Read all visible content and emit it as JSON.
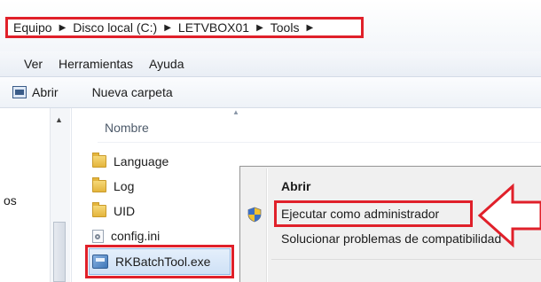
{
  "address_bar": {
    "crumbs": [
      "Equipo",
      "Disco local (C:)",
      "LETVBOX01",
      "Tools"
    ]
  },
  "menu": {
    "items": [
      "Ver",
      "Herramientas",
      "Ayuda"
    ]
  },
  "toolbar": {
    "open_label": "Abrir",
    "new_folder_label": "Nueva carpeta"
  },
  "nav_pane": {
    "partial_label": "os"
  },
  "file_list": {
    "column_name": "Nombre",
    "items": [
      {
        "name": "Language",
        "icon": "folder-icon"
      },
      {
        "name": "Log",
        "icon": "folder-icon"
      },
      {
        "name": "UID",
        "icon": "folder-icon"
      },
      {
        "name": "config.ini",
        "icon": "settings-file-icon"
      },
      {
        "name": "RKBatchTool.exe",
        "icon": "application-icon"
      }
    ]
  },
  "context_menu": {
    "items": [
      {
        "label": "Abrir",
        "bold": true
      },
      {
        "label": "Ejecutar como administrador",
        "icon": "uac-shield-icon"
      },
      {
        "label": "Solucionar problemas de compatibilidad"
      }
    ]
  },
  "colors": {
    "highlight_border": "#e0202a",
    "selection_fill": "#cfe1f6"
  }
}
